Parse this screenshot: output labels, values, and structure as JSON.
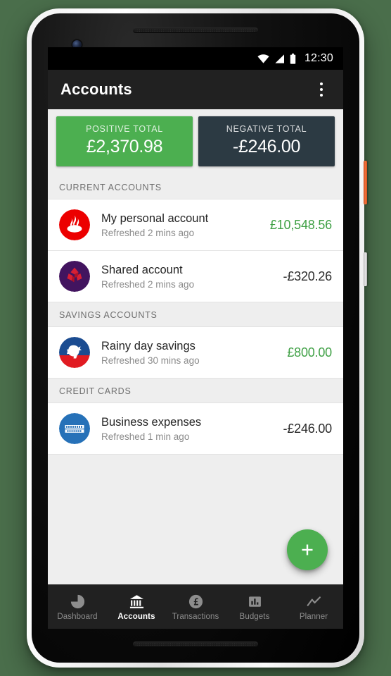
{
  "device": {
    "speaker_top": "earpiece-speaker",
    "speaker_bottom": "bottom-speaker",
    "camera": "front-camera",
    "power_button": "power-button",
    "volume_button": "volume-rocker",
    "frame_background": "#4a6e4b"
  },
  "status_bar": {
    "time": "12:30",
    "icons": [
      "wifi-icon",
      "cellular-signal-icon",
      "battery-icon"
    ]
  },
  "app_bar": {
    "title": "Accounts",
    "overflow_icon": "overflow-menu-icon"
  },
  "totals": [
    {
      "key": "positive",
      "label": "POSITIVE TOTAL",
      "amount": "£2,370.98",
      "color": "#4CAF50"
    },
    {
      "key": "negative",
      "label": "NEGATIVE TOTAL",
      "amount": "-£246.00",
      "color": "#2C3A43"
    }
  ],
  "sections": [
    {
      "header": "CURRENT ACCOUNTS",
      "accounts": [
        {
          "name": "My personal account",
          "refreshed": "Refreshed 2 mins ago",
          "balance": "£10,548.56",
          "balance_sign": "positive",
          "logo": "santander-logo"
        },
        {
          "name": "Shared account",
          "refreshed": "Refreshed 2 mins ago",
          "balance": "-£320.26",
          "balance_sign": "negative",
          "logo": "natwest-logo"
        }
      ]
    },
    {
      "header": "SAVINGS ACCOUNTS",
      "accounts": [
        {
          "name": "Rainy day savings",
          "refreshed": "Refreshed 30 mins ago",
          "balance": "£800.00",
          "balance_sign": "positive",
          "logo": "bank-of-america-logo"
        }
      ]
    },
    {
      "header": "CREDIT CARDS",
      "accounts": [
        {
          "name": "Business expenses",
          "refreshed": "Refreshed 1 min ago",
          "balance": "-£246.00",
          "balance_sign": "negative",
          "logo": "american-express-logo"
        }
      ]
    }
  ],
  "fab": {
    "icon": "plus-icon",
    "color": "#4CAF50"
  },
  "bottom_nav": {
    "items": [
      {
        "label": "Dashboard",
        "icon": "pie-chart-icon",
        "active": false
      },
      {
        "label": "Accounts",
        "icon": "bank-icon",
        "active": true
      },
      {
        "label": "Transactions",
        "icon": "pound-circle-icon",
        "active": false
      },
      {
        "label": "Budgets",
        "icon": "bar-chart-icon",
        "active": false
      },
      {
        "label": "Planner",
        "icon": "line-chart-icon",
        "active": false
      }
    ]
  },
  "colors": {
    "positive_balance": "#3FA045",
    "negative_balance": "#2b2b2b",
    "app_bar": "#212121",
    "section_background": "#eeeeee"
  }
}
